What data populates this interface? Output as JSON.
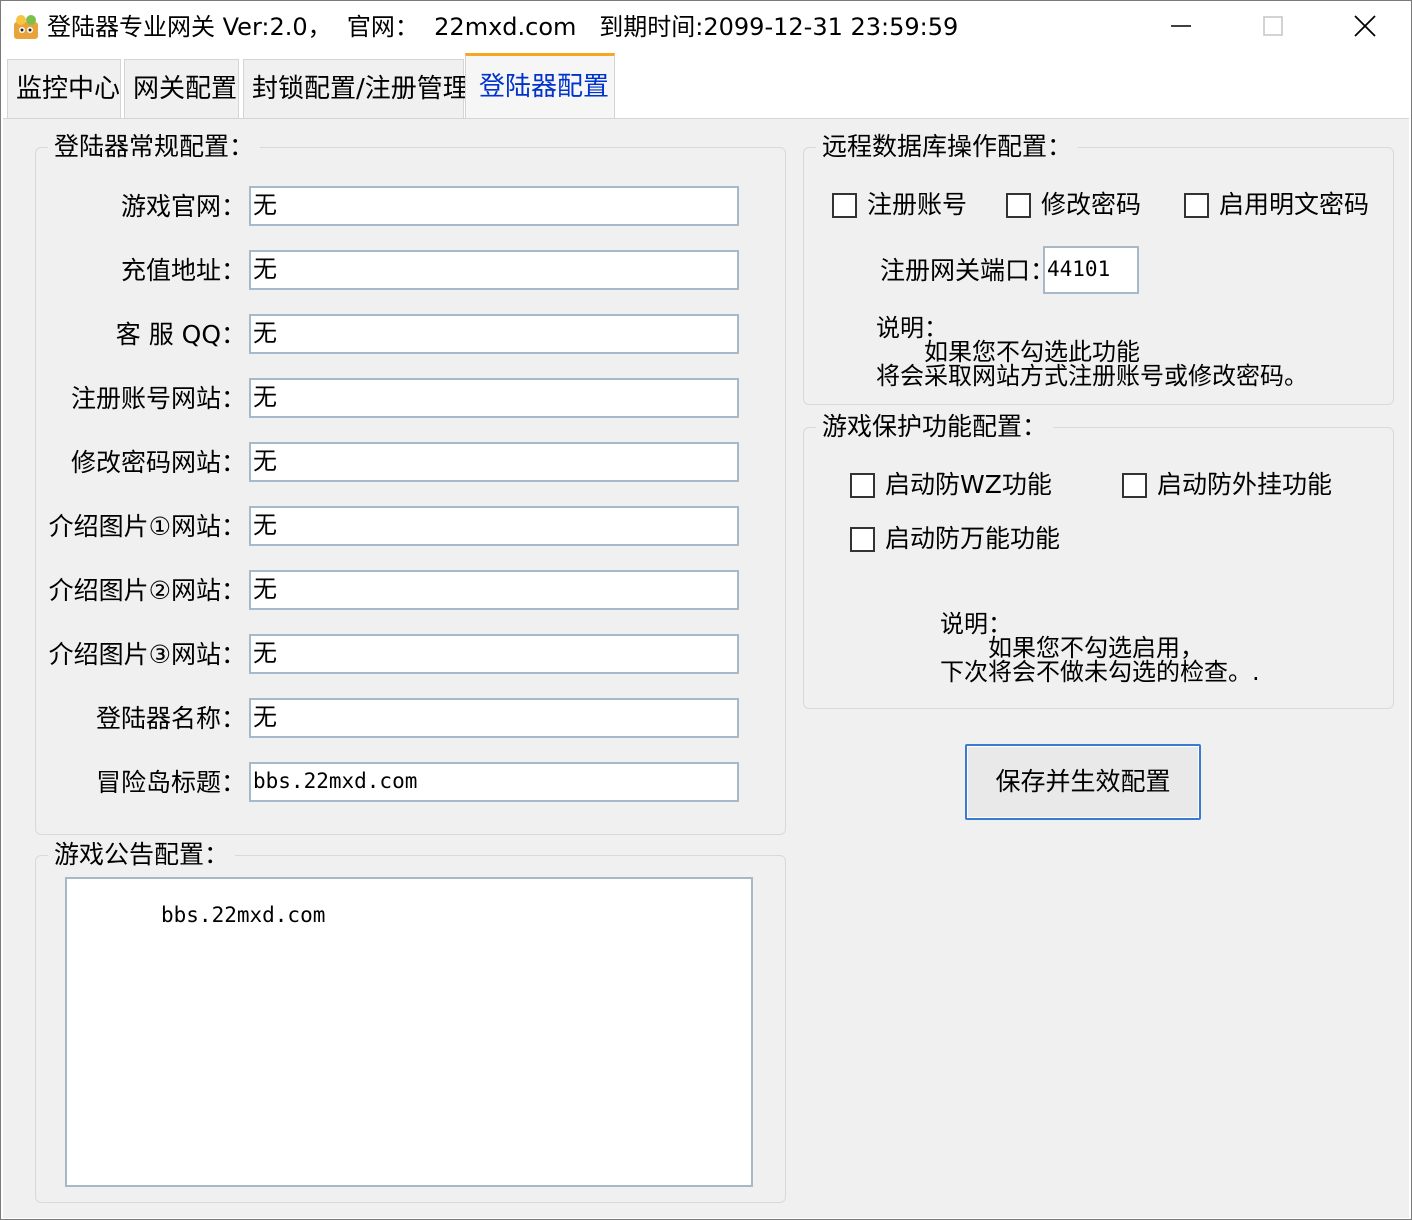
{
  "window": {
    "title": "登陆器专业网关 Ver:2.0，  官网：  22mxd.com   到期时间:2099-12-31 23:59:59",
    "controls": {
      "minimize": "minimize-icon",
      "maximize": "maximize-icon",
      "close": "close-icon"
    }
  },
  "tabs": [
    {
      "label": "监控中心"
    },
    {
      "label": "网关配置"
    },
    {
      "label": "封锁配置/注册管理"
    },
    {
      "label": "登陆器配置",
      "active": true
    }
  ],
  "general": {
    "title": "登陆器常规配置：",
    "fields": [
      {
        "label": "游戏官网：",
        "value": "无"
      },
      {
        "label": "充值地址：",
        "value": "无"
      },
      {
        "label": "客 服 QQ：",
        "value": "无"
      },
      {
        "label": "注册账号网站：",
        "value": "无"
      },
      {
        "label": "修改密码网站：",
        "value": "无"
      },
      {
        "label": "介绍图片①网站：",
        "value": "无"
      },
      {
        "label": "介绍图片②网站：",
        "value": "无"
      },
      {
        "label": "介绍图片③网站：",
        "value": "无"
      },
      {
        "label": "登陆器名称：",
        "value": "无"
      },
      {
        "label": "冒险岛标题：",
        "value": "bbs.22mxd.com"
      }
    ]
  },
  "notice": {
    "title": "游戏公告配置：",
    "text": "bbs.22mxd.com"
  },
  "remote_db": {
    "title": "远程数据库操作配置：",
    "checkboxes": [
      {
        "label": "注册账号",
        "checked": false
      },
      {
        "label": "修改密码",
        "checked": false
      },
      {
        "label": "启用明文密码",
        "checked": false
      }
    ],
    "port_label": "注册网关端口：",
    "port_value": "44101",
    "note_title": "说明：",
    "note_line1": "如果您不勾选此功能",
    "note_line2": "将会采取网站方式注册账号或修改密码。"
  },
  "protection": {
    "title": "游戏保护功能配置：",
    "checkboxes": [
      {
        "label": "启动防WZ功能",
        "checked": false
      },
      {
        "label": "启动防外挂功能",
        "checked": false
      },
      {
        "label": "启动防万能功能",
        "checked": false
      }
    ],
    "note_title": "说明：",
    "note_line1": "如果您不勾选启用，",
    "note_line2": "下次将会不做未勾选的检查。."
  },
  "save_button": "保存并生效配置",
  "colors": {
    "active_tab_text": "#0033cc",
    "active_tab_accent": "#f5a623",
    "button_border": "#3a7ad0"
  }
}
